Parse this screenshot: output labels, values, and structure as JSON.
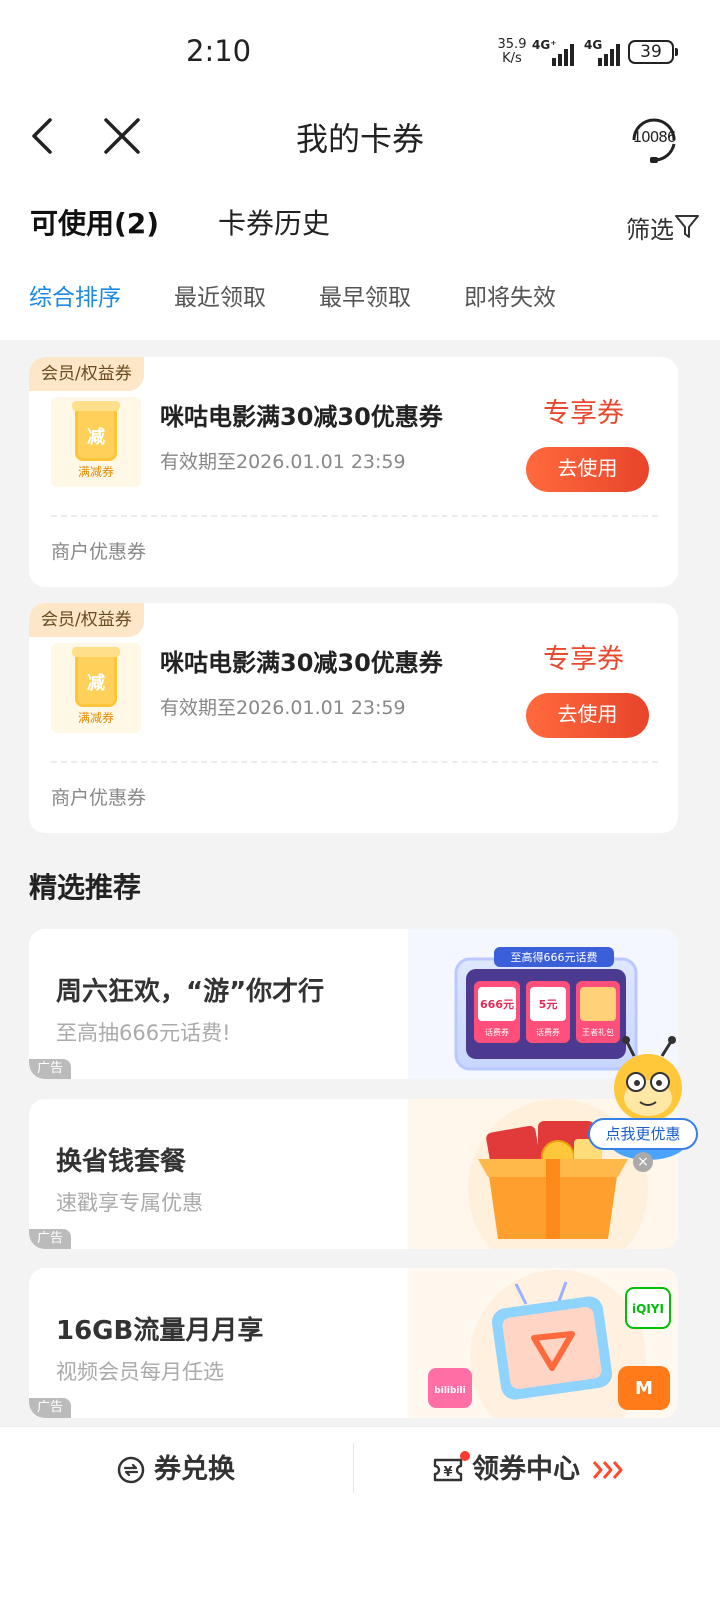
{
  "status_bar": {
    "time": "2:10",
    "net_speed": "35.9",
    "net_unit": "K/s",
    "signal1": "4G⁺",
    "signal2": "4G",
    "battery": "39"
  },
  "nav": {
    "title": "我的卡券",
    "service_label": "10086"
  },
  "tabs": {
    "available": "可使用(2)",
    "history": "卡券历史",
    "filter": "筛选"
  },
  "sort_options": [
    "综合排序",
    "最近领取",
    "最早领取",
    "即将失效"
  ],
  "coupons": [
    {
      "tag": "会员/权益券",
      "icon_char": "减",
      "icon_label": "满减券",
      "title": "咪咕电影满30减30优惠券",
      "expiry": "有效期至2026.01.01 23:59",
      "badge": "专享券",
      "button": "去使用",
      "type": "商户优惠券"
    },
    {
      "tag": "会员/权益券",
      "icon_char": "减",
      "icon_label": "满减券",
      "title": "咪咕电影满30减30优惠券",
      "expiry": "有效期至2026.01.01 23:59",
      "badge": "专享券",
      "button": "去使用",
      "type": "商户优惠券"
    }
  ],
  "section_title": "精选推荐",
  "promos": [
    {
      "title": "周六狂欢，“游”你才行",
      "subtitle": "至高抽666元话费!",
      "ad": "广告",
      "art_header": "至高得666元话费",
      "art_items": [
        "666元",
        "5元",
        "王者礼包"
      ],
      "art_sub": "话费券"
    },
    {
      "title": "换省钱套餐",
      "subtitle": "速戳享专属优惠",
      "ad": "广告"
    },
    {
      "title": "16GB流量月月享",
      "subtitle": "视频会员每月任选",
      "ad": "广告",
      "art_brand1": "iQIYI",
      "art_brand2": "bilibili"
    }
  ],
  "mascot": {
    "label": "点我更优惠",
    "close": "×"
  },
  "bottom": {
    "exchange": "券兑换",
    "center": "领券中心"
  },
  "colors": {
    "accent_blue": "#1e88e5",
    "accent_red": "#e84a2e",
    "tag_bg": "#fde7c8"
  }
}
